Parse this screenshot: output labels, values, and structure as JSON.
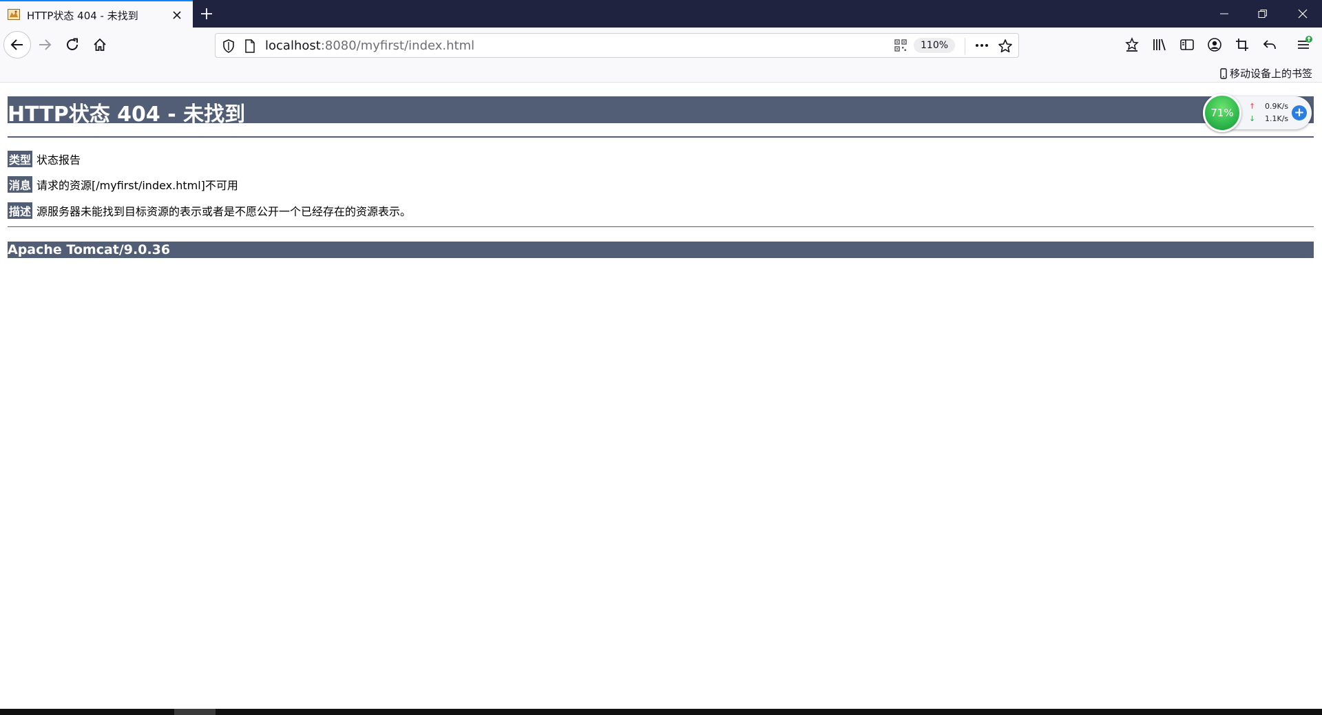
{
  "browser": {
    "tab": {
      "title": "HTTP状态 404 - 未找到",
      "favicon": "tomcat-favicon-icon",
      "close_icon": "close-icon"
    },
    "new_tab_icon": "plus-icon",
    "window_controls": [
      "minimize-icon",
      "restore-icon",
      "close-icon"
    ],
    "url": {
      "host": "localhost",
      "rest": ":8080/myfirst/index.html",
      "zoom": "110%"
    },
    "toolbar_icons": [
      "downloads-icon",
      "library-icon",
      "sidebar-icon",
      "account-icon",
      "screenshot-icon",
      "undo-icon",
      "menu-icon"
    ],
    "bookmarks": {
      "mobile_label": "移动设备上的书签"
    },
    "accent": "#0a84ff",
    "titlebar_color": "#202340"
  },
  "page": {
    "heading": "HTTP状态 404 - 未找到",
    "rows": [
      {
        "label": "类型",
        "value": "状态报告"
      },
      {
        "label": "消息",
        "value": "请求的资源[/myfirst/index.html]不可用"
      },
      {
        "label": "描述",
        "value": "源服务器未能找到目标资源的表示或者是不愿公开一个已经存在的资源表示。"
      }
    ],
    "footer": "Apache Tomcat/9.0.36",
    "bar_color": "#525d76"
  },
  "widget": {
    "percent": "71%",
    "upload": "0.9K/s",
    "download": "1.1K/s",
    "plus": "+"
  }
}
